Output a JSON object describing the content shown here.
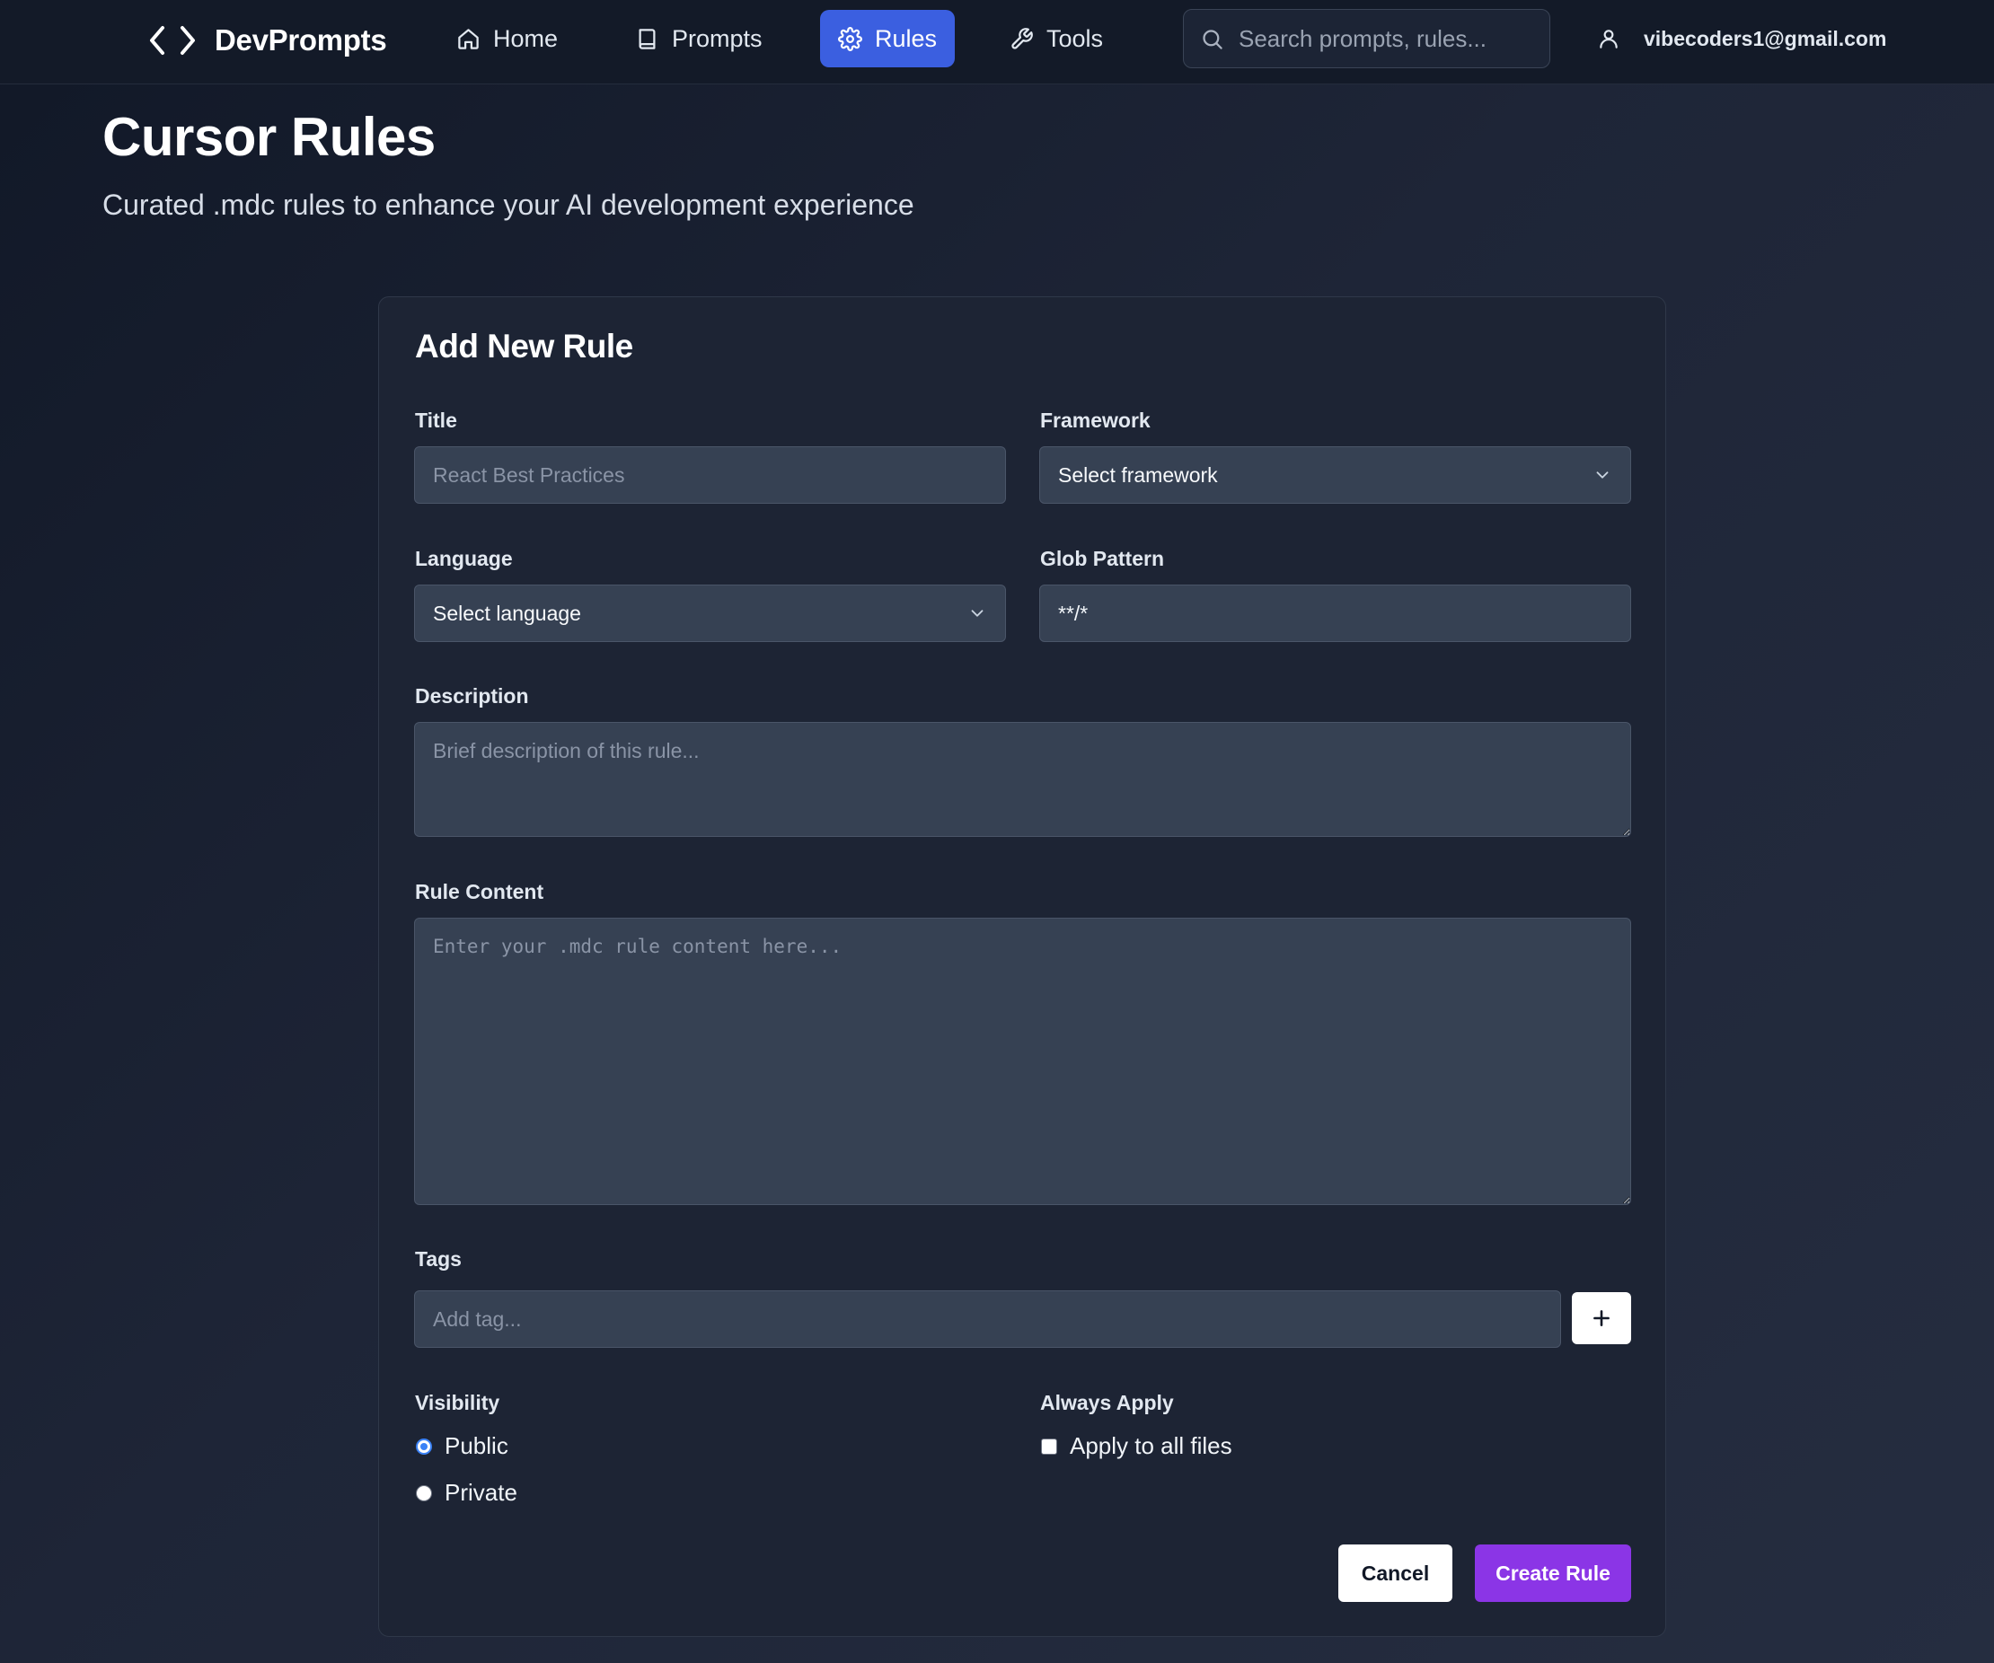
{
  "brand": {
    "name": "DevPrompts",
    "icon": "code-brackets-icon"
  },
  "nav": {
    "items": [
      {
        "label": "Home",
        "icon": "home-icon",
        "active": false
      },
      {
        "label": "Prompts",
        "icon": "book-icon",
        "active": false
      },
      {
        "label": "Rules",
        "icon": "gear-icon",
        "active": true
      },
      {
        "label": "Tools",
        "icon": "wrench-icon",
        "active": false
      }
    ],
    "accent_color": "#3b5fe0"
  },
  "search": {
    "placeholder": "Search prompts, rules...",
    "value": ""
  },
  "user": {
    "email": "vibecoders1@gmail.com",
    "icon": "user-icon"
  },
  "header": {
    "title": "Cursor Rules",
    "subtitle": "Curated .mdc rules to enhance your AI development experience"
  },
  "form": {
    "title": "Add New Rule",
    "title_label": "Title",
    "title_placeholder": "React Best Practices",
    "framework_label": "Framework",
    "framework_value": "Select framework",
    "language_label": "Language",
    "language_value": "Select language",
    "glob_label": "Glob Pattern",
    "glob_value": "**/*",
    "description_label": "Description",
    "description_placeholder": "Brief description of this rule...",
    "content_label": "Rule Content",
    "content_placeholder": "Enter your .mdc rule content here...",
    "tags_label": "Tags",
    "tags_placeholder": "Add tag...",
    "visibility_label": "Visibility",
    "visibility_options": [
      {
        "label": "Public",
        "checked": true
      },
      {
        "label": "Private",
        "checked": false
      }
    ],
    "always_apply_label": "Always Apply",
    "apply_all_label": "Apply to all files",
    "apply_all_checked": false,
    "cancel_label": "Cancel",
    "create_label": "Create Rule",
    "create_color": "#8b35e6"
  }
}
